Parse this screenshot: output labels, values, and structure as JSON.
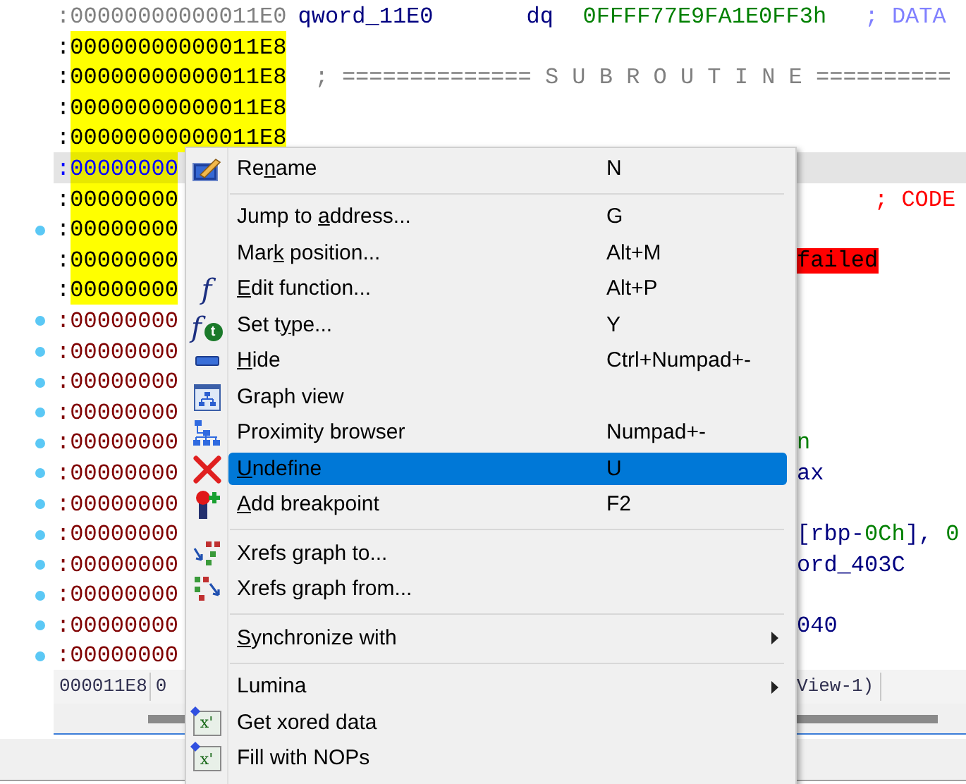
{
  "listing": {
    "rows": [
      {
        "kind": "header",
        "selected": false,
        "dot": false,
        "prefix": ":",
        "address": "00000000000011E0",
        "segments": [
          {
            "kind": "name",
            "text": "qword_11E0"
          },
          {
            "kind": "keyword",
            "text": "dq"
          },
          {
            "kind": "number",
            "text": "0FFFF77E9FA1E0FF3h"
          },
          {
            "kind": "comment",
            "text": "; DATA"
          }
        ],
        "tail": []
      },
      {
        "kind": "highlighted",
        "selected": false,
        "dot": false,
        "prefix": ":",
        "address": "00000000000011E8",
        "segments": [],
        "tail": []
      },
      {
        "kind": "highlighted",
        "selected": false,
        "dot": false,
        "prefix": ":",
        "address": "00000000000011E8",
        "segments": [
          {
            "kind": "banner",
            "text": "; ============== S U B R O U T I N E =========="
          }
        ],
        "tail": []
      },
      {
        "kind": "highlighted",
        "selected": false,
        "dot": false,
        "prefix": ":",
        "address": "00000000000011E8",
        "segments": [],
        "tail": []
      },
      {
        "kind": "highlighted",
        "selected": false,
        "dot": false,
        "prefix": ":",
        "address": "00000000000011E8",
        "segments": [],
        "tail": []
      },
      {
        "kind": "highlighted",
        "selected": true,
        "dot": false,
        "prefix": ":",
        "address": "00000000",
        "segments": [],
        "tail": []
      },
      {
        "kind": "highlighted",
        "selected": false,
        "dot": false,
        "prefix": ":",
        "address": "00000000",
        "segments": [],
        "tail": [
          {
            "kind": "codecomment",
            "text": "; CODE"
          }
        ]
      },
      {
        "kind": "highlighted",
        "selected": false,
        "dot": true,
        "prefix": ":",
        "address": "00000000",
        "segments": [],
        "tail": []
      },
      {
        "kind": "highlighted",
        "selected": false,
        "dot": false,
        "prefix": ":",
        "address": "00000000",
        "segments": [],
        "tail": [
          {
            "kind": "error",
            "text": "failed"
          }
        ]
      },
      {
        "kind": "highlighted",
        "selected": false,
        "dot": false,
        "prefix": ":",
        "address": "00000000",
        "segments": [],
        "tail": []
      },
      {
        "kind": "code",
        "selected": false,
        "dot": true,
        "prefix": ":",
        "address": "00000000",
        "segments": [],
        "tail": []
      },
      {
        "kind": "code",
        "selected": false,
        "dot": true,
        "prefix": ":",
        "address": "00000000",
        "segments": [],
        "tail": []
      },
      {
        "kind": "code",
        "selected": false,
        "dot": true,
        "prefix": ":",
        "address": "00000000",
        "segments": [],
        "tail": []
      },
      {
        "kind": "code",
        "selected": false,
        "dot": true,
        "prefix": ":",
        "address": "00000000",
        "segments": [],
        "tail": []
      },
      {
        "kind": "code",
        "selected": false,
        "dot": true,
        "prefix": ":",
        "address": "00000000",
        "segments": [],
        "tail": [
          {
            "kind": "number",
            "text": "n"
          }
        ]
      },
      {
        "kind": "code",
        "selected": false,
        "dot": true,
        "prefix": ":",
        "address": "00000000",
        "segments": [],
        "tail": [
          {
            "kind": "name",
            "text": "ax"
          }
        ]
      },
      {
        "kind": "code",
        "selected": false,
        "dot": true,
        "prefix": ":",
        "address": "00000000",
        "segments": [],
        "tail": []
      },
      {
        "kind": "code",
        "selected": false,
        "dot": true,
        "prefix": ":",
        "address": "00000000",
        "segments": [],
        "tail": [
          {
            "kind": "name",
            "text": "[rbp-"
          },
          {
            "kind": "number",
            "text": "0Ch"
          },
          {
            "kind": "name",
            "text": "], "
          },
          {
            "kind": "number",
            "text": "0"
          }
        ]
      },
      {
        "kind": "code",
        "selected": false,
        "dot": true,
        "prefix": ":",
        "address": "00000000",
        "segments": [],
        "tail": [
          {
            "kind": "name",
            "text": "ord_403C"
          }
        ]
      },
      {
        "kind": "code",
        "selected": false,
        "dot": true,
        "prefix": ":",
        "address": "00000000",
        "segments": [],
        "tail": []
      },
      {
        "kind": "code",
        "selected": false,
        "dot": true,
        "prefix": ":",
        "address": "00000000",
        "segments": [],
        "tail": [
          {
            "kind": "name",
            "text": "040"
          }
        ]
      },
      {
        "kind": "code",
        "selected": false,
        "dot": true,
        "prefix": ":",
        "address": "00000000",
        "segments": [],
        "tail": []
      }
    ],
    "status": {
      "offset": "000011E8",
      "column": "0",
      "view": "View-1)"
    }
  },
  "context_menu": {
    "items": [
      {
        "kind": "pencil",
        "label": {
          "pre": "Re",
          "key": "n",
          "post": "ame"
        },
        "shortcut": "N",
        "selected": false,
        "submenu": false
      },
      {
        "kind": "separator"
      },
      {
        "kind": "plain",
        "label": {
          "pre": "Jump to ",
          "key": "a",
          "post": "ddress..."
        },
        "shortcut": "G",
        "selected": false,
        "submenu": false
      },
      {
        "kind": "plain",
        "label": {
          "pre": "Mar",
          "key": "k",
          "post": " position..."
        },
        "shortcut": "Alt+M",
        "selected": false,
        "submenu": false
      },
      {
        "kind": "function",
        "glyph": "f",
        "label": {
          "key": "E",
          "post": "dit function..."
        },
        "shortcut": "Alt+P",
        "selected": false,
        "submenu": false
      },
      {
        "kind": "functiontype",
        "glyph": "f",
        "badge": "t",
        "label": {
          "pre": "Set t",
          "key": "y",
          "post": "pe..."
        },
        "shortcut": "Y",
        "selected": false,
        "submenu": false
      },
      {
        "kind": "minus",
        "label": {
          "key": "H",
          "post": "ide"
        },
        "shortcut": "Ctrl+Numpad+-",
        "selected": false,
        "submenu": false
      },
      {
        "kind": "graph",
        "label": {
          "pre": "Graph view"
        },
        "selected": false,
        "submenu": false
      },
      {
        "kind": "tree",
        "label": {
          "pre": "Proximity browser"
        },
        "shortcut": "Numpad+-",
        "selected": false,
        "submenu": false
      },
      {
        "kind": "cross",
        "label": {
          "key": "U",
          "post": "ndefine"
        },
        "shortcut": "U",
        "selected": true,
        "submenu": false
      },
      {
        "kind": "breakpoint",
        "label": {
          "key": "A",
          "post": "dd breakpoint"
        },
        "shortcut": "F2",
        "selected": false,
        "submenu": false
      },
      {
        "kind": "separator"
      },
      {
        "kind": "xrefsto",
        "label": {
          "pre": "Xrefs graph to..."
        },
        "selected": false,
        "submenu": false
      },
      {
        "kind": "xrefsfrom",
        "label": {
          "pre": "Xrefs graph from..."
        },
        "selected": false,
        "submenu": false
      },
      {
        "kind": "separator"
      },
      {
        "kind": "plain",
        "label": {
          "key": "S",
          "post": "ynchronize with"
        },
        "selected": false,
        "submenu": true
      },
      {
        "kind": "separator"
      },
      {
        "kind": "plain",
        "label": {
          "pre": "Lumina"
        },
        "selected": false,
        "submenu": true
      },
      {
        "kind": "xor",
        "glyph": "x'",
        "label": {
          "pre": "Get xored data"
        },
        "selected": false,
        "submenu": false
      },
      {
        "kind": "xor",
        "glyph": "x'",
        "label": {
          "pre": "Fill with NOPs"
        },
        "selected": false,
        "submenu": false
      }
    ]
  }
}
